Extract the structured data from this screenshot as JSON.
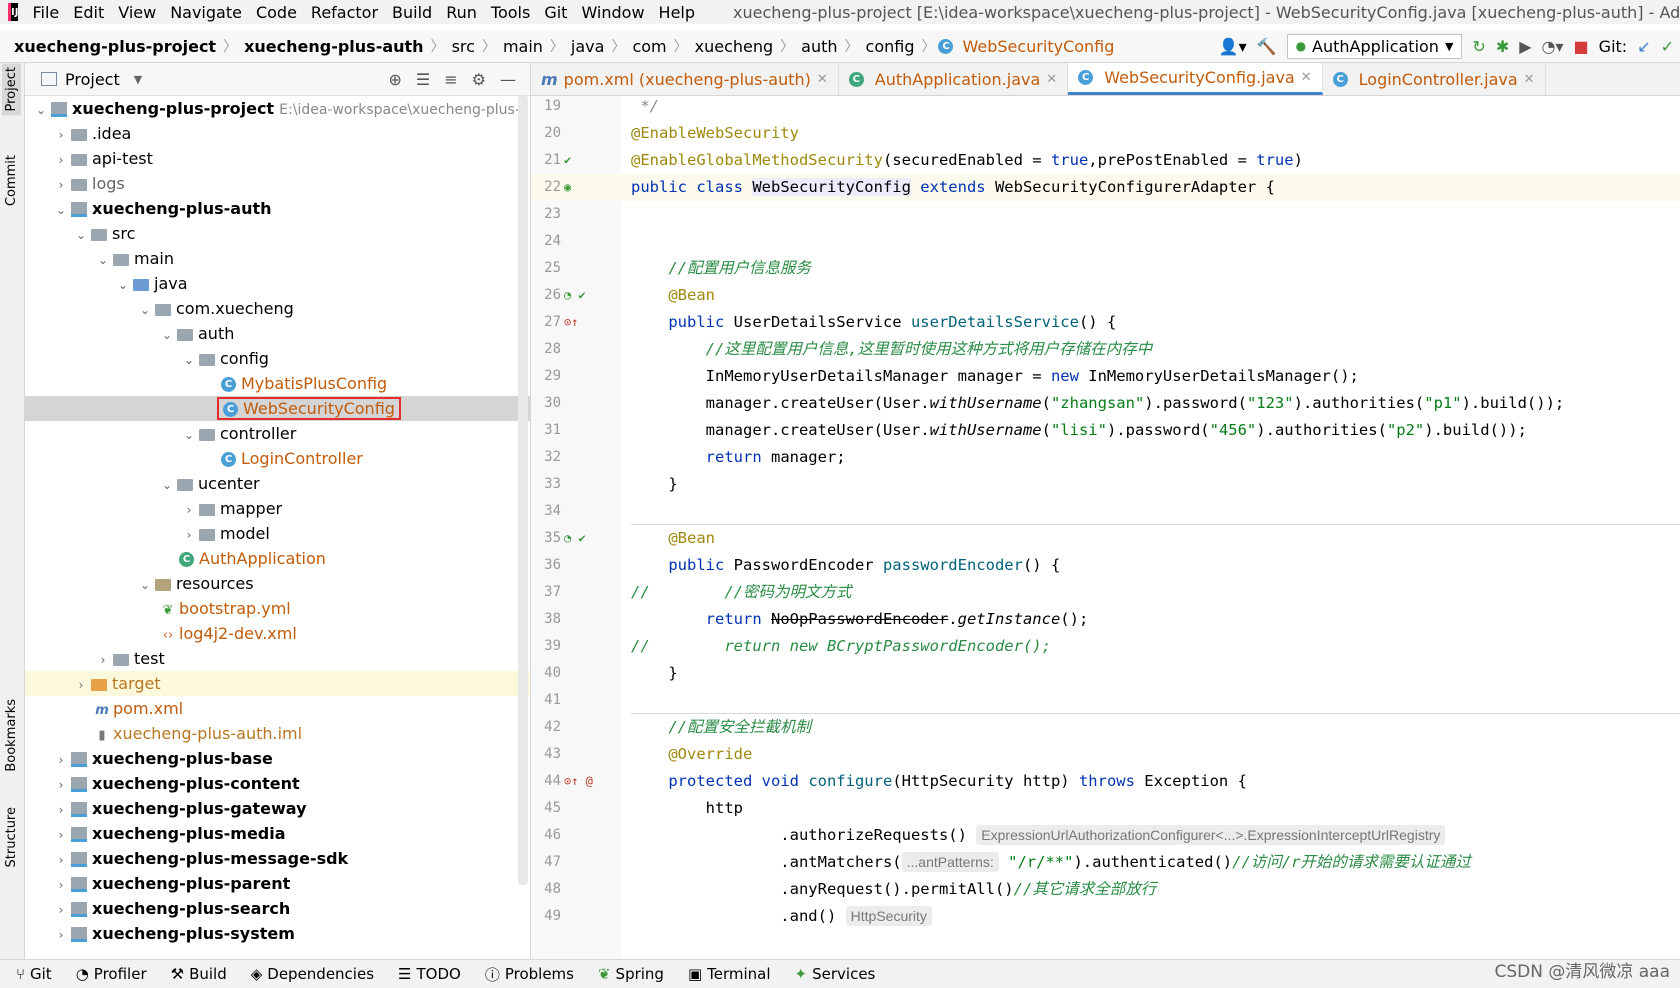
{
  "menu": {
    "items": [
      "File",
      "Edit",
      "View",
      "Navigate",
      "Code",
      "Refactor",
      "Build",
      "Run",
      "Tools",
      "Git",
      "Window",
      "Help"
    ],
    "window_title": "xuecheng-plus-project [E:\\idea-workspace\\xuecheng-plus-project] - WebSecurityConfig.java [xuecheng-plus-auth] - Administrat"
  },
  "breadcrumb": {
    "items": [
      "xuecheng-plus-project",
      "xuecheng-plus-auth",
      "src",
      "main",
      "java",
      "com",
      "xuecheng",
      "auth",
      "config",
      "WebSecurityConfig"
    ]
  },
  "toolbar": {
    "run_config": "AuthApplication",
    "git_label": "Git:"
  },
  "left_strip": {
    "project": "Project",
    "commit": "Commit",
    "bookmarks": "Bookmarks",
    "structure": "Structure"
  },
  "project_panel": {
    "title": "Project",
    "root_label": "xuecheng-plus-project",
    "root_path": "E:\\idea-workspace\\xuecheng-plus-pr",
    "tree": [
      {
        "label": ".idea"
      },
      {
        "label": "api-test"
      },
      {
        "label": "logs"
      },
      {
        "label": "xuecheng-plus-auth"
      },
      {
        "label": "src"
      },
      {
        "label": "main"
      },
      {
        "label": "java"
      },
      {
        "label": "com.xuecheng"
      },
      {
        "label": "auth"
      },
      {
        "label": "config"
      },
      {
        "label": "MybatisPlusConfig"
      },
      {
        "label": "WebSecurityConfig"
      },
      {
        "label": "controller"
      },
      {
        "label": "LoginController"
      },
      {
        "label": "ucenter"
      },
      {
        "label": "mapper"
      },
      {
        "label": "model"
      },
      {
        "label": "AuthApplication"
      },
      {
        "label": "resources"
      },
      {
        "label": "bootstrap.yml"
      },
      {
        "label": "log4j2-dev.xml"
      },
      {
        "label": "test"
      },
      {
        "label": "target"
      },
      {
        "label": "pom.xml"
      },
      {
        "label": "xuecheng-plus-auth.iml"
      },
      {
        "label": "xuecheng-plus-base"
      },
      {
        "label": "xuecheng-plus-content"
      },
      {
        "label": "xuecheng-plus-gateway"
      },
      {
        "label": "xuecheng-plus-media"
      },
      {
        "label": "xuecheng-plus-message-sdk"
      },
      {
        "label": "xuecheng-plus-parent"
      },
      {
        "label": "xuecheng-plus-search"
      },
      {
        "label": "xuecheng-plus-system"
      }
    ]
  },
  "editor_tabs": [
    {
      "label": "pom.xml (xuecheng-plus-auth)"
    },
    {
      "label": "AuthApplication.java"
    },
    {
      "label": "WebSecurityConfig.java"
    },
    {
      "label": "LoginController.java"
    }
  ],
  "code": {
    "line_numbers": [
      "19",
      "20",
      "21",
      "22",
      "23",
      "24",
      "25",
      "26",
      "27",
      "28",
      "29",
      "30",
      "31",
      "32",
      "33",
      "34",
      "35",
      "36",
      "37",
      "38",
      "39",
      "40",
      "41",
      "42",
      "43",
      "44",
      "45",
      "46",
      "47",
      "48",
      "49"
    ],
    "l19": " */",
    "l20": "@EnableWebSecurity",
    "l21_a": "@EnableGlobalMethodSecurity",
    "l21_b": "(securedEnabled = ",
    "l21_c": "true",
    "l21_d": ",prePostEnabled = ",
    "l21_e": "true",
    "l21_f": ")",
    "l22_a": "public class ",
    "l22_b": "WebSecurityConfig",
    "l22_c": " extends ",
    "l22_d": "WebSecurityConfigurerAdapter {",
    "l25": "    //配置用户信息服务",
    "l26": "    @Bean",
    "l27_a": "    public ",
    "l27_b": "UserDetailsService ",
    "l27_c": "userDetailsService",
    "l27_d": "() {",
    "l28": "        //这里配置用户信息,这里暂时使用这种方式将用户存储在内存中",
    "l29_a": "        InMemoryUserDetailsManager manager = ",
    "l29_b": "new ",
    "l29_c": "InMemoryUserDetailsManager();",
    "l30_a": "        manager.createUser(User.",
    "l30_b": "withUsername",
    "l30_c": "(",
    "l30_d": "\"zhangsan\"",
    "l30_e": ").password(",
    "l30_f": "\"123\"",
    "l30_g": ").authorities(",
    "l30_h": "\"p1\"",
    "l30_i": ").build());",
    "l31_a": "        manager.createUser(User.",
    "l31_b": "withUsername",
    "l31_c": "(",
    "l31_d": "\"lisi\"",
    "l31_e": ").password(",
    "l31_f": "\"456\"",
    "l31_g": ").authorities(",
    "l31_h": "\"p2\"",
    "l31_i": ").build());",
    "l32_a": "        ",
    "l32_b": "return ",
    "l32_c": "manager;",
    "l33": "    }",
    "l35": "    @Bean",
    "l36_a": "    public ",
    "l36_b": "PasswordEncoder ",
    "l36_c": "passwordEncoder",
    "l36_d": "() {",
    "l37_a": "//",
    "l37_b": "        //密码为明文方式",
    "l38_a": "        ",
    "l38_b": "return ",
    "l38_c": "NoOpPasswordEncoder",
    "l38_d": ".",
    "l38_e": "getInstance",
    "l38_f": "();",
    "l39_a": "//",
    "l39_b": "        return new BCryptPasswordEncoder();",
    "l40": "    }",
    "l42": "    //配置安全拦截机制",
    "l43": "    @Override",
    "l44_a": "    protected void ",
    "l44_b": "configure",
    "l44_c": "(HttpSecurity http) ",
    "l44_d": "throws ",
    "l44_e": "Exception {",
    "l45": "        http",
    "l46_a": "                .authorizeRequests()",
    "l46_hint": "ExpressionUrlAuthorizationConfigurer<...>.ExpressionInterceptUrlRegistry",
    "l47_a": "                .antMatchers(",
    "l47_hint": "...antPatterns:",
    "l47_b": "\"/r/**\"",
    "l47_c": ").authenticated()",
    "l47_d": "//访问/r开始的请求需要认证通过",
    "l48_a": "                .anyRequest().permitAll()",
    "l48_b": "//其它请求全部放行",
    "l49_a": "                .and()",
    "l49_hint": "HttpSecurity"
  },
  "bottom_tabs": [
    "Git",
    "Profiler",
    "Build",
    "Dependencies",
    "TODO",
    "Problems",
    "Spring",
    "Terminal",
    "Services"
  ],
  "watermark": "CSDN @清风微凉 aaa",
  "colors": {
    "accent": "#4083c9",
    "selection_border": "#e52b2b",
    "keyword": "#0033b3",
    "string": "#067d17",
    "annotation": "#9e880d"
  }
}
